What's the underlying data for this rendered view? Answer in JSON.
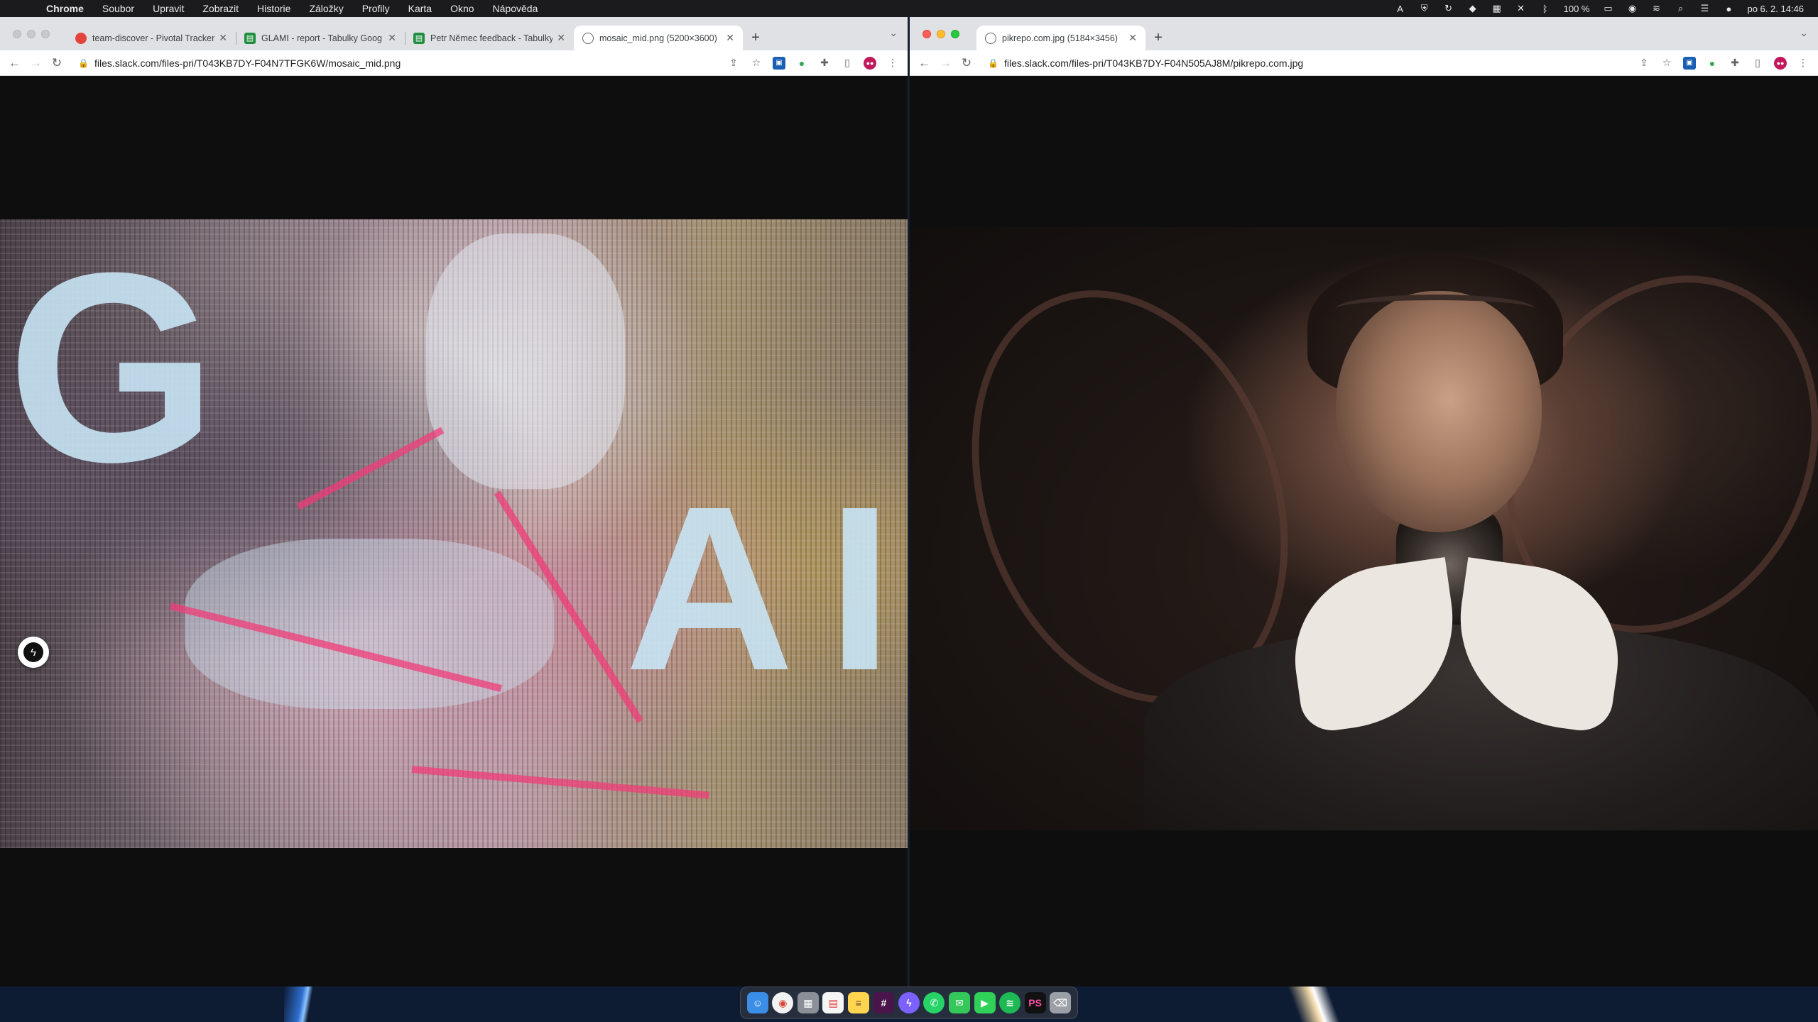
{
  "menubar": {
    "app_name": "Chrome",
    "items": [
      "Soubor",
      "Upravit",
      "Zobrazit",
      "Historie",
      "Záložky",
      "Profily",
      "Karta",
      "Okno",
      "Nápověda"
    ],
    "battery": "100 %",
    "datetime": "po 6. 2.  14:46"
  },
  "left_window": {
    "tabs": [
      {
        "title": "team-discover - Pivotal Tracker",
        "favicon": "pivotal-icon"
      },
      {
        "title": "GLAMI - report - Tabulky Goog",
        "favicon": "sheets-icon"
      },
      {
        "title": "Petr Němec feedback - Tabulky",
        "favicon": "sheets-icon"
      },
      {
        "title": "mosaic_mid.png (5200×3600)",
        "favicon": "globe-icon"
      }
    ],
    "url": "files.slack.com/files-pri/T043KB7DY-F04N7TFGK6W/mosaic_mid.png",
    "image_letters": [
      "G",
      "A",
      "I"
    ]
  },
  "right_window": {
    "tabs": [
      {
        "title": "pikrepo.com.jpg (5184×3456)",
        "favicon": "globe-icon"
      }
    ],
    "url": "files.slack.com/files-pri/T043KB7DY-F04N505AJ8M/pikrepo.com.jpg"
  },
  "colors": {
    "menubar_bg": "#1b1b1d",
    "tabstrip_bg": "#dfe1e5",
    "viewport_bg": "#0e0e0e"
  }
}
